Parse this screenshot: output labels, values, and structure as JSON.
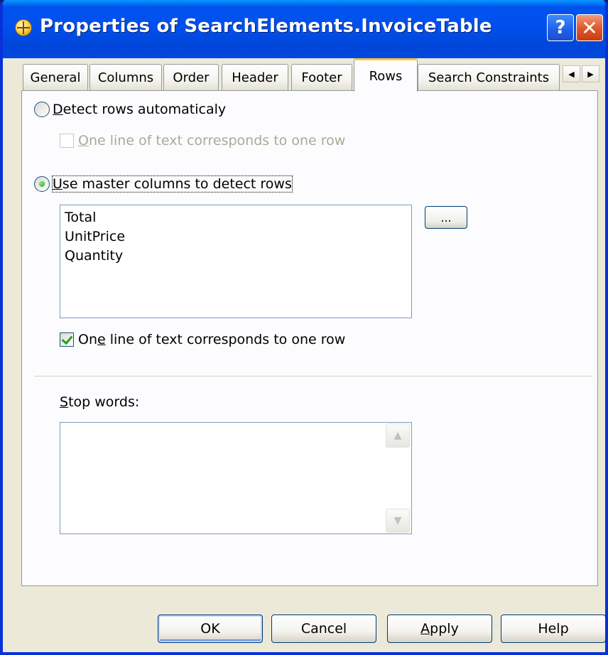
{
  "window": {
    "title": "Properties of SearchElements.InvoiceTable",
    "help_label": "?",
    "close_label": "✕"
  },
  "tabs": [
    {
      "label": "General"
    },
    {
      "label": "Columns"
    },
    {
      "label": "Order"
    },
    {
      "label": "Header"
    },
    {
      "label": "Footer"
    },
    {
      "label": "Rows",
      "selected": true
    },
    {
      "label": "Search Constraints"
    }
  ],
  "tab_scroll": {
    "left": "◀",
    "right": "▶"
  },
  "rows": {
    "detect_auto": {
      "prefix": "D",
      "rest": "etect rows automaticaly",
      "checked": false
    },
    "auto_one_line": {
      "prefix": "O",
      "rest": "ne line of text corresponds to one row",
      "checked": false,
      "disabled": true
    },
    "use_master": {
      "prefix": "U",
      "rest": "se master columns to detect rows",
      "checked": true
    },
    "master_columns": [
      "Total",
      "UnitPrice",
      "Quantity"
    ],
    "browse_label": "...",
    "master_one_line": {
      "prefix": "On",
      "accel": "e",
      "rest": " line of text corresponds to one row",
      "checked": true
    },
    "stop_words": {
      "prefix": "S",
      "rest": "top words:",
      "value": ""
    }
  },
  "buttons": {
    "ok": "OK",
    "cancel": "Cancel",
    "apply_accel": "A",
    "apply_rest": "pply",
    "help": "Help"
  },
  "colors": {
    "titlebar": "#0054e3",
    "face": "#ece9d8",
    "tab_highlight": "#ffc83c"
  }
}
